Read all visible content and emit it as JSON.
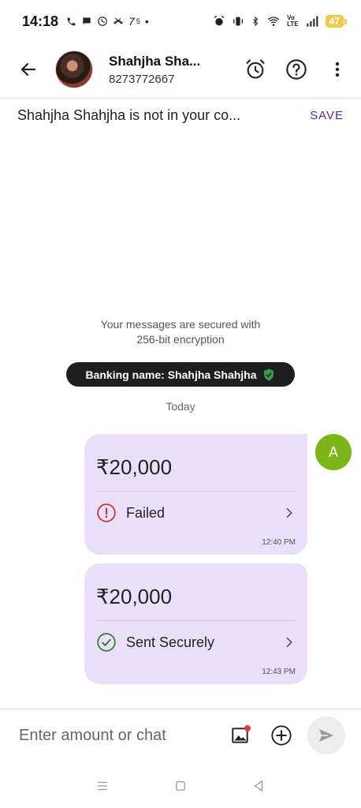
{
  "status_bar": {
    "time": "14:18",
    "left_icons": [
      "phone-icon",
      "chat-bubble-icon",
      "whatsapp-icon",
      "missed-call-icon",
      "temperature-icon",
      "dot"
    ],
    "temperature": "7",
    "right_icons": [
      "alarm-icon",
      "vibrate-icon",
      "bluetooth-icon",
      "wifi-icon",
      "volte-icon",
      "signal-icon"
    ],
    "battery": "47"
  },
  "header": {
    "contact_name": "Shahjha  Sha...",
    "contact_phone": "8273772667",
    "icons": [
      "alarm-clock-icon",
      "help-icon",
      "more-vert-icon"
    ]
  },
  "contact_notice": {
    "text": "Shahjha  Shahjha is not in your co...",
    "save_label": "SAVE"
  },
  "security": {
    "line1": "Your messages are secured with",
    "line2": "256-bit encryption"
  },
  "banking_name": {
    "text": "Banking name: Shahjha  Shahjha"
  },
  "date_divider": "Today",
  "user_avatar_initial": "A",
  "messages": [
    {
      "amount": "₹20,000",
      "status": "Failed",
      "time": "12:40 PM",
      "status_color": "#d32f2f"
    },
    {
      "amount": "₹20,000",
      "status": "Sent Securely",
      "time": "12:43 PM",
      "status_color": "#2e7d32"
    }
  ],
  "composer": {
    "placeholder": "Enter amount or chat"
  },
  "colors": {
    "accent": "#5f259f",
    "bubble_bg": "#eadff9",
    "avatar_bg": "#7cb518",
    "pill_bg": "#1e1e1e"
  }
}
